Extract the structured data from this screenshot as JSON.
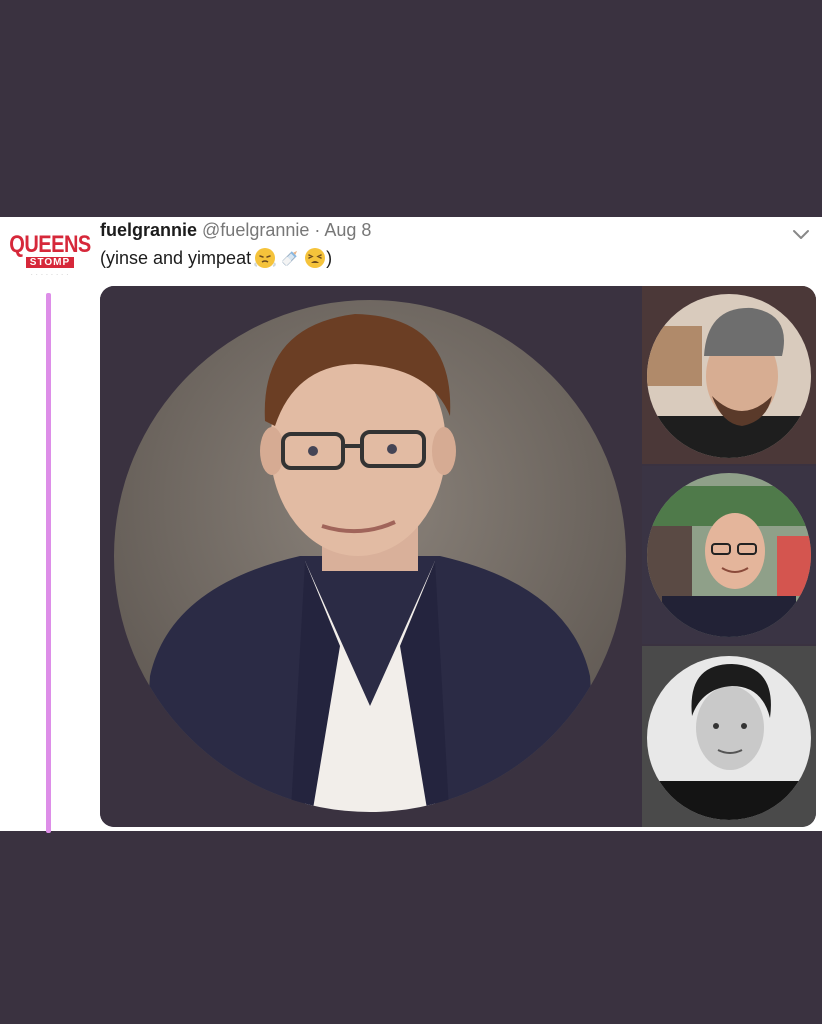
{
  "tweet": {
    "avatar_logo": {
      "top": "QUEENS",
      "mid": "STOMP"
    },
    "display_name": "fuelgrannie",
    "handle": "@fuelgrannie",
    "separator": "·",
    "date": "Aug 8",
    "text_open": "(yinse and yimpeat",
    "text_close": ")",
    "emojis": [
      "face-with-steam-emoji",
      "baby-bottle-emoji",
      "tired-face-emoji"
    ]
  },
  "media": {
    "main_photo": "man-in-suit-portrait",
    "thumbnails": [
      "man-in-cap-photo",
      "bald-man-with-glasses-photo",
      "man-black-white-photo"
    ]
  },
  "colors": {
    "background": "#3a3240",
    "thread_line": "#dd8ee8",
    "logo_red": "#d6283a",
    "secondary_text": "#777777"
  }
}
